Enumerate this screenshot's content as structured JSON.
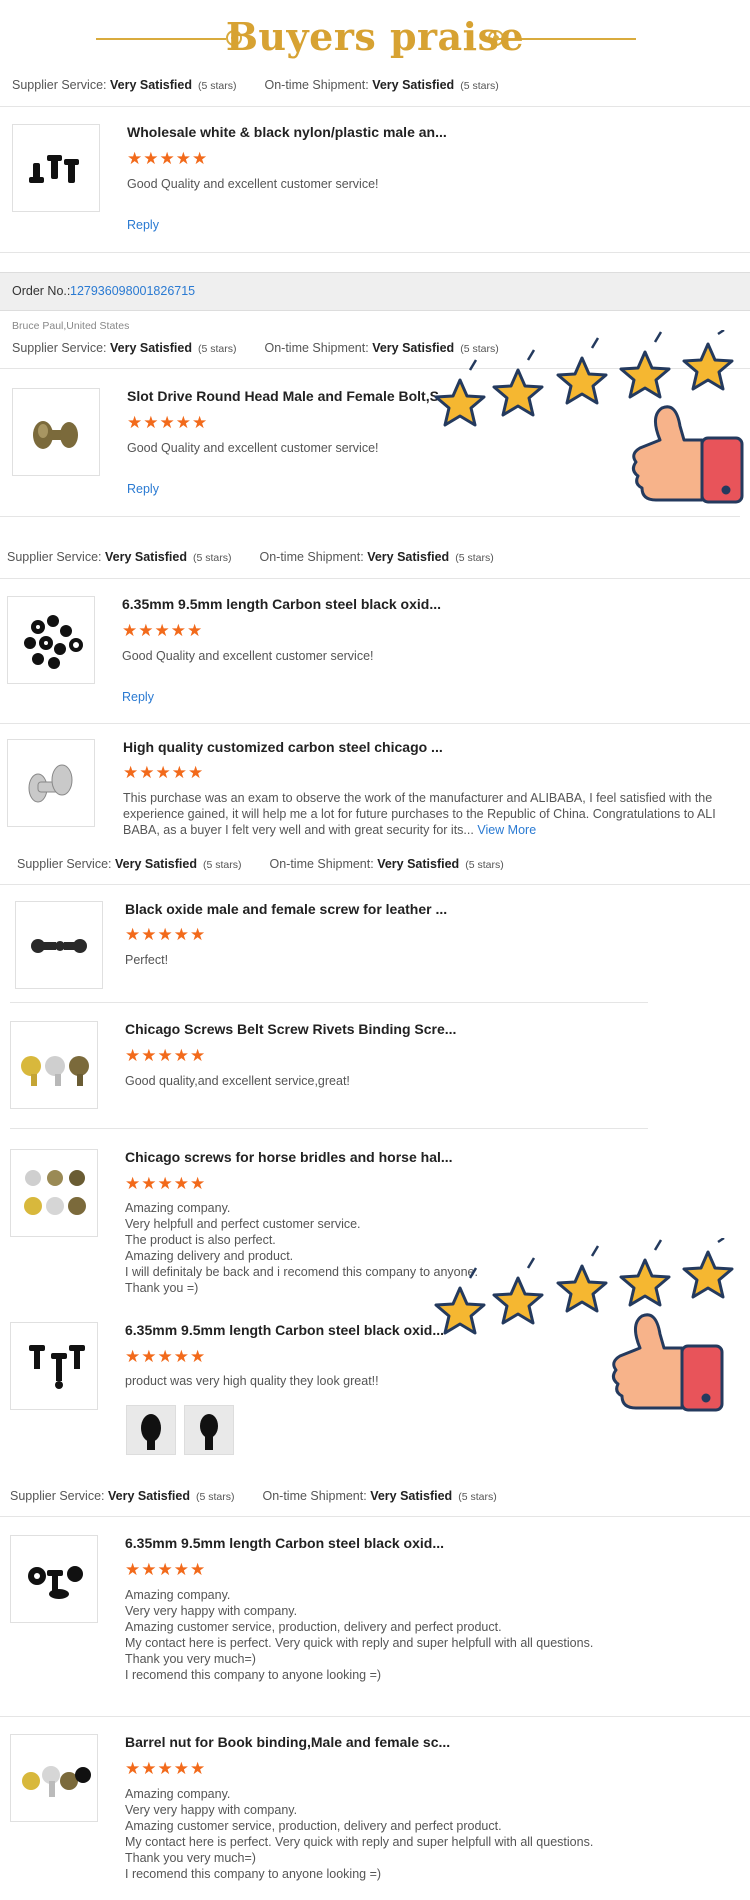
{
  "header": {
    "title": "Buyers praise"
  },
  "labels": {
    "supplier": "Supplier Service:",
    "very": "Very Satisfied",
    "five": "(5 stars)",
    "ontime": "On-time Shipment:",
    "reply": "Reply",
    "order_no": "Order No.:",
    "view_more": "View More"
  },
  "stars": "★★★★★",
  "order": {
    "number": "127936098001826715",
    "buyer": "Bruce Paul,United States"
  },
  "reviews": [
    {
      "title": "Wholesale white & black nylon/plastic male an...",
      "comment": "Good Quality and excellent customer service!",
      "reply": "Reply"
    },
    {
      "title": "Slot Drive Round Head Male and Female Bolt,S...",
      "comment": "Good Quality and excellent customer service!",
      "reply": "Reply"
    },
    {
      "title": "6.35mm 9.5mm length Carbon steel black oxid...",
      "comment": "Good Quality and excellent customer service!",
      "reply": "Reply"
    },
    {
      "title": "High quality customized carbon steel chicago ...",
      "comment": "This purchase was an exam to observe the work of the manufacturer and ALIBABA, I feel satisfied with the\nexperience gained, it will help me a lot for future purchases to the Republic of China. Congratulations to ALI\nBABA, as a buyer I felt very well and with great security for its..."
    },
    {
      "title": "Black oxide male and female screw for leather ...",
      "comment": "Perfect!"
    },
    {
      "title": "Chicago Screws Belt Screw Rivets Binding Scre...",
      "comment": "Good quality,and excellent service,great!"
    },
    {
      "title": "Chicago screws for horse bridles and horse hal...",
      "comment": "Amazing company.\nVery helpfull and perfect customer service.\nThe product is also perfect.\nAmazing delivery and product.\nI will definitaly be back and i recomend this company to anyone.\nThank you =)"
    },
    {
      "title": "6.35mm 9.5mm length Carbon steel black oxid...",
      "comment": "product was very high quality they look great!!"
    },
    {
      "title": "6.35mm 9.5mm length Carbon steel black oxid...",
      "comment": "Amazing company.\nVery very happy with company.\nAmazing customer service, production, delivery and perfect product.\nMy contact here is perfect. Very quick with reply and super helpfull with all questions.\nThank you very much=)\nI recomend this company to anyone looking =)"
    },
    {
      "title": "Barrel nut for Book binding,Male and female sc...",
      "comment": "Amazing company.\nVery very happy with company.\nAmazing customer service, production, delivery and perfect product.\nMy contact here is perfect. Very quick with reply and super helpfull with all questions.\nThank you very much=)\nI recomend this company to anyone looking =)"
    }
  ],
  "colors": {
    "gold": "#d7a232",
    "star": "#f26a1b",
    "link": "#2a7ad2",
    "sticker_star": "#f5b731",
    "thumb": "#f7b38a",
    "cuff": "#e8545a"
  }
}
